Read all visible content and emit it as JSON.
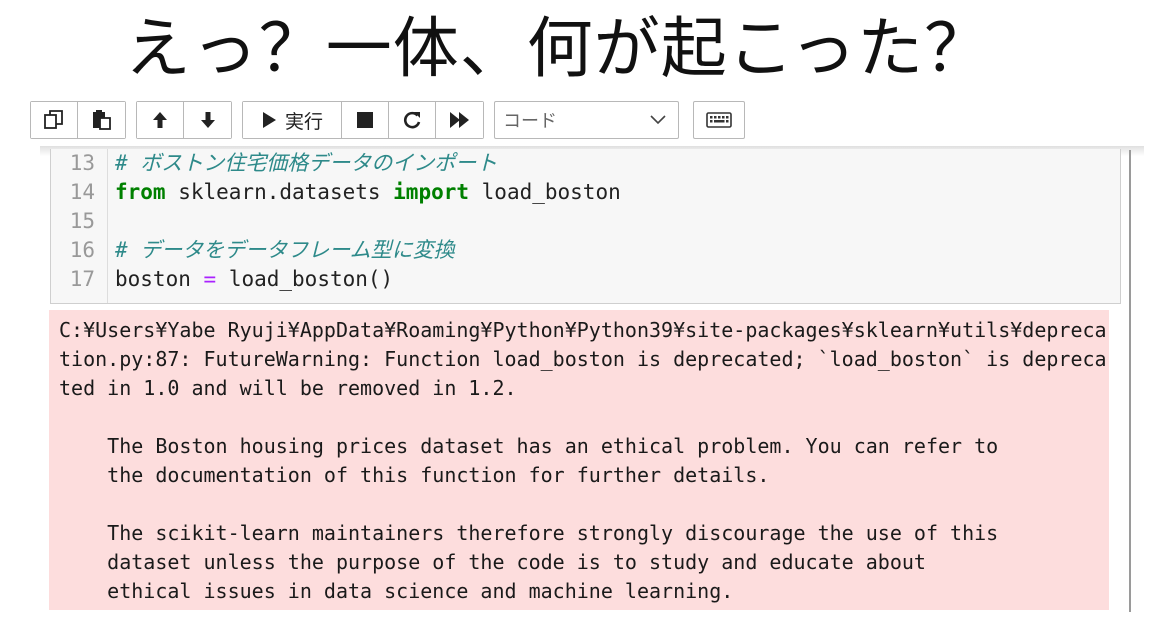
{
  "headline": "えっ？一体、何が起こった？",
  "toolbar": {
    "copy_icon": "copy-icon",
    "paste_icon": "paste-icon",
    "move_up_icon": "arrow-up-icon",
    "move_down_icon": "arrow-down-icon",
    "run_label": "実行",
    "stop_icon": "stop-icon",
    "restart_icon": "restart-icon",
    "run_all_icon": "fast-forward-icon",
    "cell_type_value": "コード",
    "keyboard_icon": "keyboard-icon"
  },
  "code": {
    "lines": [
      {
        "num": "13",
        "comment": "# ボストン住宅価格データのインポート"
      },
      {
        "num": "14",
        "kw1": "from",
        "mid": " sklearn.datasets ",
        "kw2": "import",
        "tail": " load_boston"
      },
      {
        "num": "15"
      },
      {
        "num": "16",
        "comment": "# データをデータフレーム型に変換"
      },
      {
        "num": "17",
        "head": "boston ",
        "op": "=",
        "tail": " load_boston()"
      }
    ]
  },
  "output": {
    "lines": [
      "C:¥Users¥Yabe Ryuji¥AppData¥Roaming¥Python¥Python39¥site-packages¥sklearn¥utils¥depreca",
      "tion.py:87: FutureWarning: Function load_boston is deprecated; `load_boston` is depreca",
      "ted in 1.0 and will be removed in 1.2.",
      "",
      "    The Boston housing prices dataset has an ethical problem. You can refer to",
      "    the documentation of this function for further details.",
      "",
      "    The scikit-learn maintainers therefore strongly discourage the use of this",
      "    dataset unless the purpose of the code is to study and educate about",
      "    ethical issues in data science and machine learning."
    ]
  },
  "colors": {
    "comment": "#2e8a8a",
    "keyword": "#008000",
    "operator": "#aa22ff",
    "stderr_bg": "#fddddd"
  }
}
